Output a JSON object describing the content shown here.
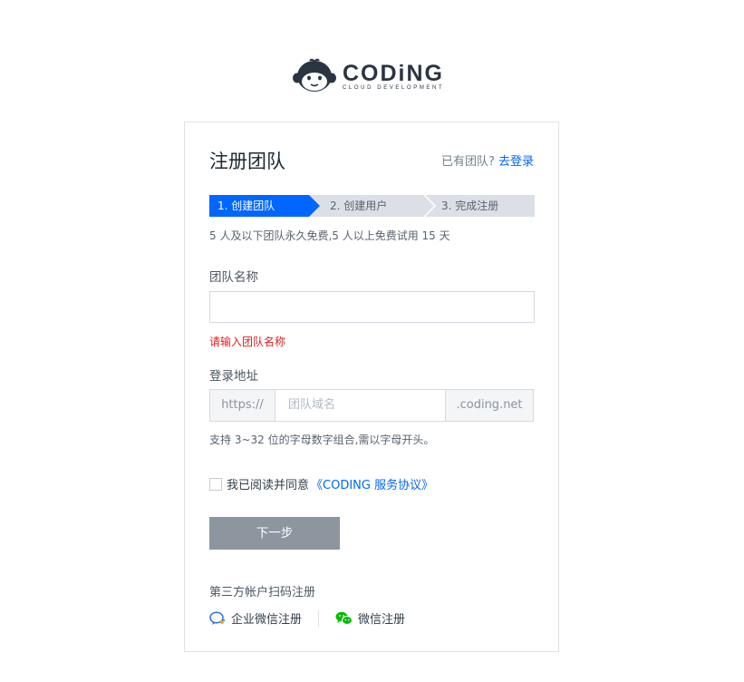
{
  "brand": {
    "name": "CODiNG",
    "tagline": "CLOUD DEVELOPMENT"
  },
  "card": {
    "title": "注册团队",
    "login_prompt": "已有团队?",
    "login_link": "去登录"
  },
  "steps": [
    {
      "label": "1. 创建团队",
      "active": true
    },
    {
      "label": "2. 创建用户",
      "active": false
    },
    {
      "label": "3. 完成注册",
      "active": false
    }
  ],
  "note": "5 人及以下团队永久免费,5 人以上免费试用 15 天",
  "team_name": {
    "label": "团队名称",
    "value": "",
    "error": "请输入团队名称"
  },
  "login_address": {
    "label": "登录地址",
    "prefix": "https://",
    "placeholder": "团队域名",
    "suffix": ".coding.net",
    "hint": "支持 3~32 位的字母数字组合,需以字母开头。"
  },
  "agreement": {
    "text": "我已阅读并同意",
    "link": "《CODING 服务协议》",
    "checked": false
  },
  "next_button": "下一步",
  "third_party": {
    "title": "第三方帐户扫码注册",
    "options": [
      {
        "label": "企业微信注册",
        "icon": "wecom-icon"
      },
      {
        "label": "微信注册",
        "icon": "wechat-icon"
      }
    ]
  },
  "colors": {
    "accent": "#0066ff",
    "error": "#e02020",
    "button_disabled": "#8d969f",
    "wechat": "#09bb07"
  }
}
